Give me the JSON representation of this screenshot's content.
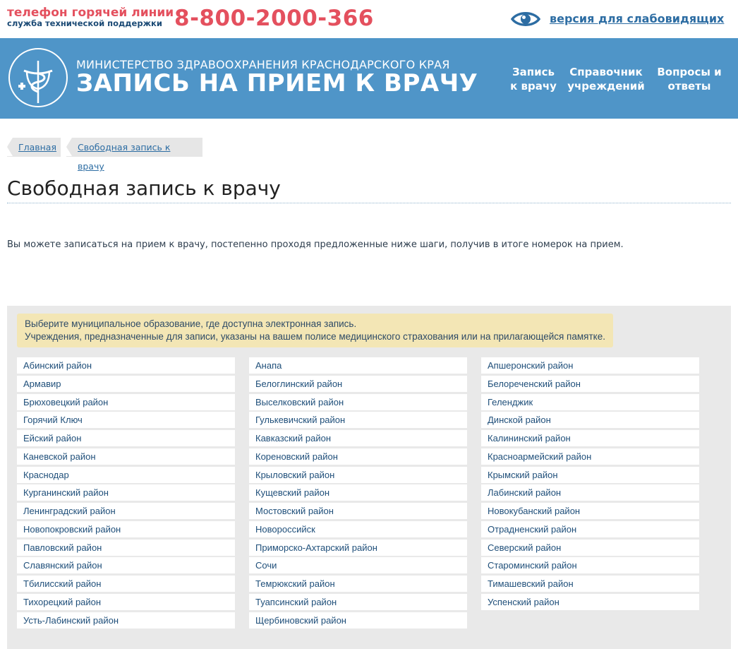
{
  "topbar": {
    "hotline_title": "телефон горячей линии",
    "hotline_subtitle": "служба технической поддержки",
    "phone": "8-800-2000-366",
    "vision_link": "версия для слабовидящих"
  },
  "header": {
    "ministry": "МИНИСТЕРСТВО ЗДРАВООХРАНЕНИЯ КРАСНОДАРСКОГО КРАЯ",
    "title": "ЗАПИСЬ НА ПРИЕМ К ВРАЧУ",
    "nav": [
      {
        "line1": "Запись",
        "line2": "к врачу"
      },
      {
        "line1": "Справочник",
        "line2": "учреждений"
      },
      {
        "line1": "Вопросы и",
        "line2": "ответы"
      }
    ]
  },
  "breadcrumb": [
    "Главная",
    "Свободная запись к врачу"
  ],
  "page_title": "Свободная запись к врачу",
  "intro": "Вы можете записаться на прием к врачу, постепенно проходя предложенные ниже шаги, получив в итоге номерок на прием.",
  "notice": {
    "line1": "Выберите муниципальное образование, где доступна электронная запись.",
    "line2": "Учреждения, предназначенные для записи, указаны на вашем полисе медицинского страхования или на прилагающейся памятке."
  },
  "districts": {
    "col1": [
      "Абинский район",
      "Армавир",
      "Брюховецкий район",
      "Горячий Ключ",
      "Ейский район",
      "Каневской район",
      "Краснодар",
      "Курганинский район",
      "Ленинградский район",
      "Новопокровский район",
      "Павловский район",
      "Славянский район",
      "Тбилисский район",
      "Тихорецкий район",
      "Усть-Лабинский район"
    ],
    "col2": [
      "Анапа",
      "Белоглинский район",
      "Выселковский район",
      "Гулькевичский район",
      "Кавказский район",
      "Кореновский район",
      "Крыловский район",
      "Кущевский район",
      "Мостовский район",
      "Новороссийск",
      "Приморско-Ахтарский район",
      "Сочи",
      "Темрюкский район",
      "Туапсинский район",
      "Щербиновский район"
    ],
    "col3": [
      "Апшеронский район",
      "Белореченский район",
      "Геленджик",
      "Динской район",
      "Калининский район",
      "Красноармейский район",
      "Крымский район",
      "Лабинский район",
      "Новокубанский район",
      "Отрадненский район",
      "Северский район",
      "Староминский район",
      "Тимашевский район",
      "Успенский район"
    ]
  },
  "colors": {
    "accent": "#4f95c8",
    "hotline": "#e4505e",
    "link": "#2d6da3",
    "notice_bg": "#f3e6b5",
    "panel_bg": "#e9e9e9"
  },
  "icons": {
    "vision": "eye-icon",
    "logo": "ministry-logo-icon"
  }
}
